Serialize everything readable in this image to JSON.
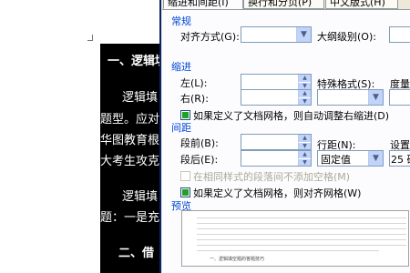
{
  "document": {
    "lines": [
      "一、逻辑填",
      "逻辑填",
      "题型。应对",
      "华图教育根",
      "大考生攻克",
      "逻辑填",
      "题：一是充",
      "二、借"
    ]
  },
  "dialog": {
    "tabs": [
      "缩进和间距(I)",
      "换行和分页(P)",
      "中文版式(H)"
    ],
    "sections": {
      "general": "常规",
      "indent": "缩进",
      "spacing": "间距",
      "preview": "预览"
    },
    "general": {
      "alignment_label": "对齐方式(G):",
      "outline_label": "大纲级别(O):"
    },
    "indent": {
      "left_label": "左(L):",
      "right_label": "右(R):",
      "special_label": "特殊格式(S):",
      "by_label": "度量值",
      "auto_adjust_label": "如果定义了文档网格，则自动调整右缩进(D)"
    },
    "spacing": {
      "before_label": "段前(B):",
      "after_label": "段后(E):",
      "line_label": "行距(N):",
      "line_value": "固定值",
      "at_label": "设置值",
      "at_value": "25 磅",
      "no_space_label": "在相同样式的段落间不添加空格(M)",
      "snap_grid_label": "如果定义了文档网格，则对齐网格(W)"
    },
    "preview": {
      "sample_text": "一、逻辑填空题的答题技巧"
    }
  }
}
